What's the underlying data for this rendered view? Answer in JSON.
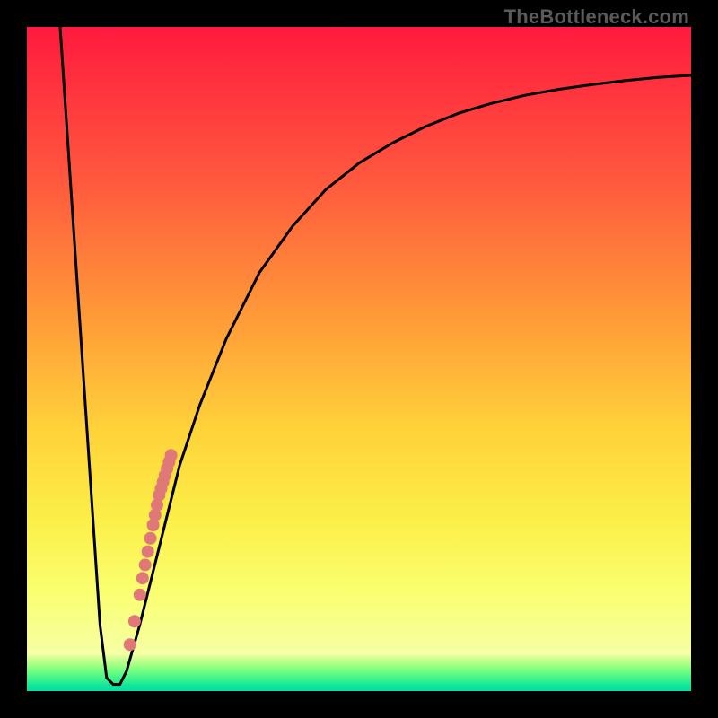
{
  "watermark": "TheBottleneck.com",
  "colors": {
    "curve": "#000000",
    "dots": "#e07878",
    "background_top": "#ff1a3e",
    "background_mid": "#ffd23a",
    "background_bottom": "#00e0a6"
  },
  "chart_data": {
    "type": "line",
    "title": "",
    "xlabel": "",
    "ylabel": "",
    "xlim": [
      0,
      100
    ],
    "ylim": [
      0,
      100
    ],
    "curve": {
      "x": [
        5,
        6,
        7,
        8,
        9,
        10,
        11,
        12,
        13,
        14,
        15,
        17,
        20,
        23,
        26,
        30,
        35,
        40,
        45,
        50,
        55,
        60,
        65,
        70,
        75,
        80,
        85,
        90,
        95,
        100
      ],
      "y": [
        100,
        85,
        70,
        55,
        40,
        25,
        10,
        2,
        1,
        1,
        3,
        10,
        22,
        34,
        43,
        53,
        63,
        70,
        75.5,
        79.5,
        82.5,
        85,
        87,
        88.5,
        89.7,
        90.6,
        91.3,
        91.9,
        92.4,
        92.7
      ]
    },
    "dots": {
      "x": [
        15.5,
        16.2,
        17.0,
        17.4,
        17.8,
        18.2,
        18.6,
        19.0,
        19.3,
        19.6,
        19.9,
        20.2,
        20.5,
        20.8,
        21.1,
        21.4,
        21.7
      ],
      "y": [
        7,
        10.5,
        14.5,
        17,
        19,
        21,
        23,
        25,
        26.5,
        28,
        29.5,
        30.5,
        31.5,
        32.5,
        33.5,
        34.5,
        35.5
      ]
    }
  }
}
